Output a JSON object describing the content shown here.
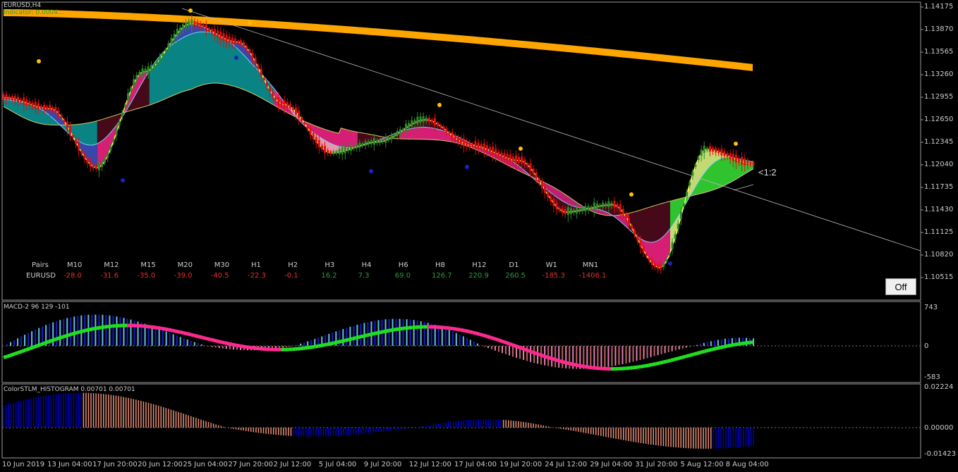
{
  "main": {
    "symbol_title": "EURUSD,H4",
    "subtitle": "Indicator: 0.0004...",
    "price_ticks": [
      "1.14175",
      "1.13870",
      "1.13565",
      "1.13260",
      "1.12955",
      "1.12650",
      "1.12345",
      "1.12040",
      "1.11735",
      "1.11430",
      "1.11125",
      "1.10820",
      "1.10515"
    ],
    "ratio_label": "<1:2",
    "off_button": "Off"
  },
  "strength_table": {
    "pairs_header": "Pairs",
    "pair": "EURUSD",
    "columns": [
      {
        "tf": "M10",
        "value": "-28.0",
        "color": "#e8302a"
      },
      {
        "tf": "M12",
        "value": "-31.6",
        "color": "#e8302a"
      },
      {
        "tf": "M15",
        "value": "-35.0",
        "color": "#e8302a"
      },
      {
        "tf": "M20",
        "value": "-39.0",
        "color": "#e8302a"
      },
      {
        "tf": "M30",
        "value": "-40.5",
        "color": "#e8302a"
      },
      {
        "tf": "H1",
        "value": "-22.3",
        "color": "#e8302a"
      },
      {
        "tf": "H2",
        "value": "-0.1",
        "color": "#e8302a"
      },
      {
        "tf": "H3",
        "value": "16.2",
        "color": "#2e9e3a"
      },
      {
        "tf": "H4",
        "value": "7.3",
        "color": "#2e9e3a"
      },
      {
        "tf": "H6",
        "value": "69.0",
        "color": "#2e9e3a"
      },
      {
        "tf": "H8",
        "value": "126.7",
        "color": "#2e9e3a"
      },
      {
        "tf": "H12",
        "value": "220.9",
        "color": "#2e9e3a"
      },
      {
        "tf": "D1",
        "value": "260.5",
        "color": "#2e9e3a"
      },
      {
        "tf": "W1",
        "value": "-185.3",
        "color": "#e8302a"
      },
      {
        "tf": "MN1",
        "value": "-1406.1",
        "color": "#e8302a"
      }
    ]
  },
  "macd": {
    "title": "MACD-2 96 129 -101",
    "ticks": [
      "743",
      "0",
      "-583"
    ]
  },
  "stlm": {
    "title": "ColorSTLM_HISTOGRAM 0.00701 0.00701",
    "ticks": [
      "0.02224",
      "0.00000",
      "-0.01423"
    ]
  },
  "time_axis": [
    "10 Jun 2019",
    "13 Jun 04:00",
    "17 Jun 20:00",
    "20 Jun 12:00",
    "25 Jun 04:00",
    "27 Jun 20:00",
    "2 Jul 12:00",
    "5 Jul 04:00",
    "9 Jul 20:00",
    "12 Jul 12:00",
    "17 Jul 04:00",
    "19 Jul 20:00",
    "24 Jul 12:00",
    "29 Jul 04:00",
    "31 Jul 20:00",
    "5 Aug 12:00",
    "8 Aug 04:00"
  ],
  "colors": {
    "ma_orange": "#ffa500",
    "bull_candle": "#2e8b2e",
    "bear_candle": "#e01010",
    "cloud_blue": "#3b4bb5",
    "cloud_teal": "#0a8a8a",
    "cloud_pink": "#e0207a",
    "cloud_maroon": "#4a0a1a",
    "cloud_green": "#32cd32",
    "macd_pink": "#ff2a90",
    "macd_green": "#20e020",
    "hist_blue": "#0000c0",
    "hist_salmon": "#e8907a"
  },
  "chart_data": {
    "type": "line",
    "title": "EURUSD,H4",
    "x": [
      "10 Jun 2019",
      "13 Jun 04:00",
      "17 Jun 20:00",
      "20 Jun 12:00",
      "25 Jun 04:00",
      "27 Jun 20:00",
      "2 Jul 12:00",
      "5 Jul 04:00",
      "9 Jul 20:00",
      "12 Jul 12:00",
      "17 Jul 04:00",
      "19 Jul 20:00",
      "24 Jul 12:00",
      "29 Jul 04:00",
      "31 Jul 20:00",
      "5 Aug 12:00",
      "8 Aug 04:00"
    ],
    "series": [
      {
        "values": [
          1.1295,
          1.128,
          1.12,
          1.133,
          1.1395,
          1.137,
          1.1285,
          1.122,
          1.1235,
          1.1265,
          1.123,
          1.121,
          1.114,
          1.115,
          1.1065,
          1.1225,
          1.1205
        ]
      }
    ],
    "ylim": [
      1.104,
      1.143
    ],
    "grid": false
  }
}
